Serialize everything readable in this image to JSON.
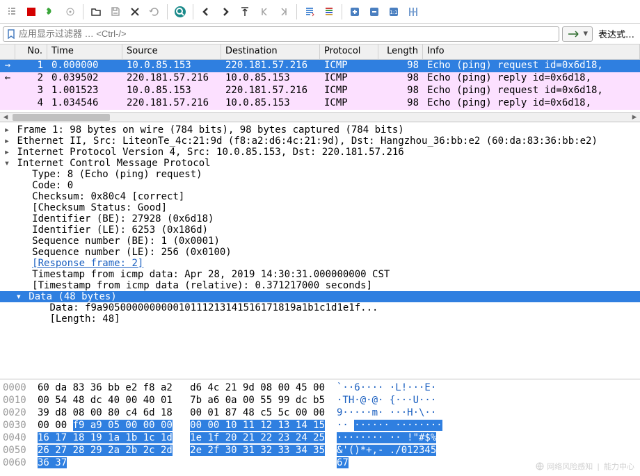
{
  "toolbar_icons": [
    {
      "name": "list-icon",
      "g": "list",
      "disabled": true
    },
    {
      "name": "stop-icon",
      "g": "stop",
      "color": "#d40000"
    },
    {
      "name": "restart-icon",
      "g": "fin",
      "color": "#3aa63a"
    },
    {
      "name": "options-icon",
      "g": "opts",
      "disabled": true
    },
    {
      "sep": true
    },
    {
      "name": "open-icon",
      "g": "open"
    },
    {
      "name": "save-icon",
      "g": "save",
      "disabled": true
    },
    {
      "name": "close-icon",
      "g": "close"
    },
    {
      "name": "reload-icon",
      "g": "reload",
      "disabled": true
    },
    {
      "sep": true
    },
    {
      "name": "find-icon",
      "g": "find",
      "accent": true
    },
    {
      "sep": true
    },
    {
      "name": "back-icon",
      "g": "back"
    },
    {
      "name": "forward-icon",
      "g": "fwd"
    },
    {
      "name": "jump-icon",
      "g": "jump"
    },
    {
      "name": "first-icon",
      "g": "first",
      "disabled": true
    },
    {
      "name": "last-icon",
      "g": "last",
      "disabled": true
    },
    {
      "sep": true
    },
    {
      "name": "autoscroll-icon",
      "g": "autoscr",
      "pressed": true
    },
    {
      "name": "colorize-icon",
      "g": "colorize",
      "pressed": true
    },
    {
      "sep": true
    },
    {
      "name": "zoom-in-icon",
      "g": "plus"
    },
    {
      "name": "zoom-out-icon",
      "g": "minus"
    },
    {
      "name": "zoom100-icon",
      "g": "oneone"
    },
    {
      "name": "resize-columns-icon",
      "g": "rescol"
    }
  ],
  "filter": {
    "placeholder": "应用显示过滤器 … <Ctrl-/>",
    "expr_btn": "表达式…"
  },
  "packet_list": {
    "headers": [
      "No.",
      "Time",
      "Source",
      "Destination",
      "Protocol",
      "Length",
      "Info"
    ],
    "rows": [
      {
        "no": "1",
        "time": "0.000000",
        "src": "10.0.85.153",
        "dst": "220.181.57.216",
        "proto": "ICMP",
        "len": "98",
        "info": "Echo (ping) request  id=0x6d18,",
        "selected": true,
        "arrow": "→"
      },
      {
        "no": "2",
        "time": "0.039502",
        "src": "220.181.57.216",
        "dst": "10.0.85.153",
        "proto": "ICMP",
        "len": "98",
        "info": "Echo (ping) reply    id=0x6d18,",
        "arrow": "←"
      },
      {
        "no": "3",
        "time": "1.001523",
        "src": "10.0.85.153",
        "dst": "220.181.57.216",
        "proto": "ICMP",
        "len": "98",
        "info": "Echo (ping) request  id=0x6d18,"
      },
      {
        "no": "4",
        "time": "1.034546",
        "src": "220.181.57.216",
        "dst": "10.0.85.153",
        "proto": "ICMP",
        "len": "98",
        "info": "Echo (ping) reply    id=0x6d18,"
      }
    ]
  },
  "details": {
    "frame": "Frame 1: 98 bytes on wire (784 bits), 98 bytes captured (784 bits)",
    "eth": "Ethernet II, Src: LiteonTe_4c:21:9d (f8:a2:d6:4c:21:9d), Dst: Hangzhou_36:bb:e2 (60:da:83:36:bb:e2)",
    "ip": "Internet Protocol Version 4, Src: 10.0.85.153, Dst: 220.181.57.216",
    "icmp": "Internet Control Message Protocol",
    "type": "Type: 8 (Echo (ping) request)",
    "code": "Code: 0",
    "cksum": "Checksum: 0x80c4 [correct]",
    "ckstat": "[Checksum Status: Good]",
    "idbe": "Identifier (BE): 27928 (0x6d18)",
    "idle": "Identifier (LE): 6253 (0x186d)",
    "seqbe": "Sequence number (BE): 1 (0x0001)",
    "seqle": "Sequence number (LE): 256 (0x0100)",
    "resp": "[Response frame: 2]",
    "ts": "Timestamp from icmp data: Apr 28, 2019 14:30:31.000000000 CST",
    "tsrel": "[Timestamp from icmp data (relative): 0.371217000 seconds]",
    "data_hdr": "Data (48 bytes)",
    "data": "Data: f9a905000000000010111213141516171819a1b1c1d1e1f...",
    "length": "[Length: 48]"
  },
  "hex": {
    "rows": [
      {
        "off": "0000",
        "b1": "60 da 83 36 bb e2 f8 a2",
        "b2": "d6 4c 21 9d 08 00 45 00",
        "a": "`··6···· ·L!···E·"
      },
      {
        "off": "0010",
        "b1": "00 54 48 dc 40 00 40 01",
        "b2": "7b a6 0a 00 55 99 dc b5",
        "a": "·TH·@·@· {···U···"
      },
      {
        "off": "0020",
        "b1": "39 d8 08 00 80 c4 6d 18",
        "b2": "00 01 87 48 c5 5c 00 00",
        "a": "9·····m· ···H·\\··"
      },
      {
        "off": "0030",
        "b1p": "00 00 ",
        "b1s": "f9 a9 05 00 00 00",
        "b2s": "00 00 10 11 12 13 14 15",
        "ap": "·· ",
        "as": "······ ········",
        "atail": ""
      },
      {
        "off": "0040",
        "b1s": "16 17 18 19 1a 1b 1c 1d",
        "b2s": "1e 1f 20 21 22 23 24 25",
        "as": "········ ·· !\"#$%"
      },
      {
        "off": "0050",
        "b1s": "26 27 28 29 2a 2b 2c 2d",
        "b2s": "2e 2f 30 31 32 33 34 35",
        "as": "&'()*+,- ./012345"
      },
      {
        "off": "0060",
        "b1s": "36 37",
        "as": "67"
      }
    ]
  },
  "watermark": {
    "a": "网络风险感知",
    "b": "能力中心"
  }
}
